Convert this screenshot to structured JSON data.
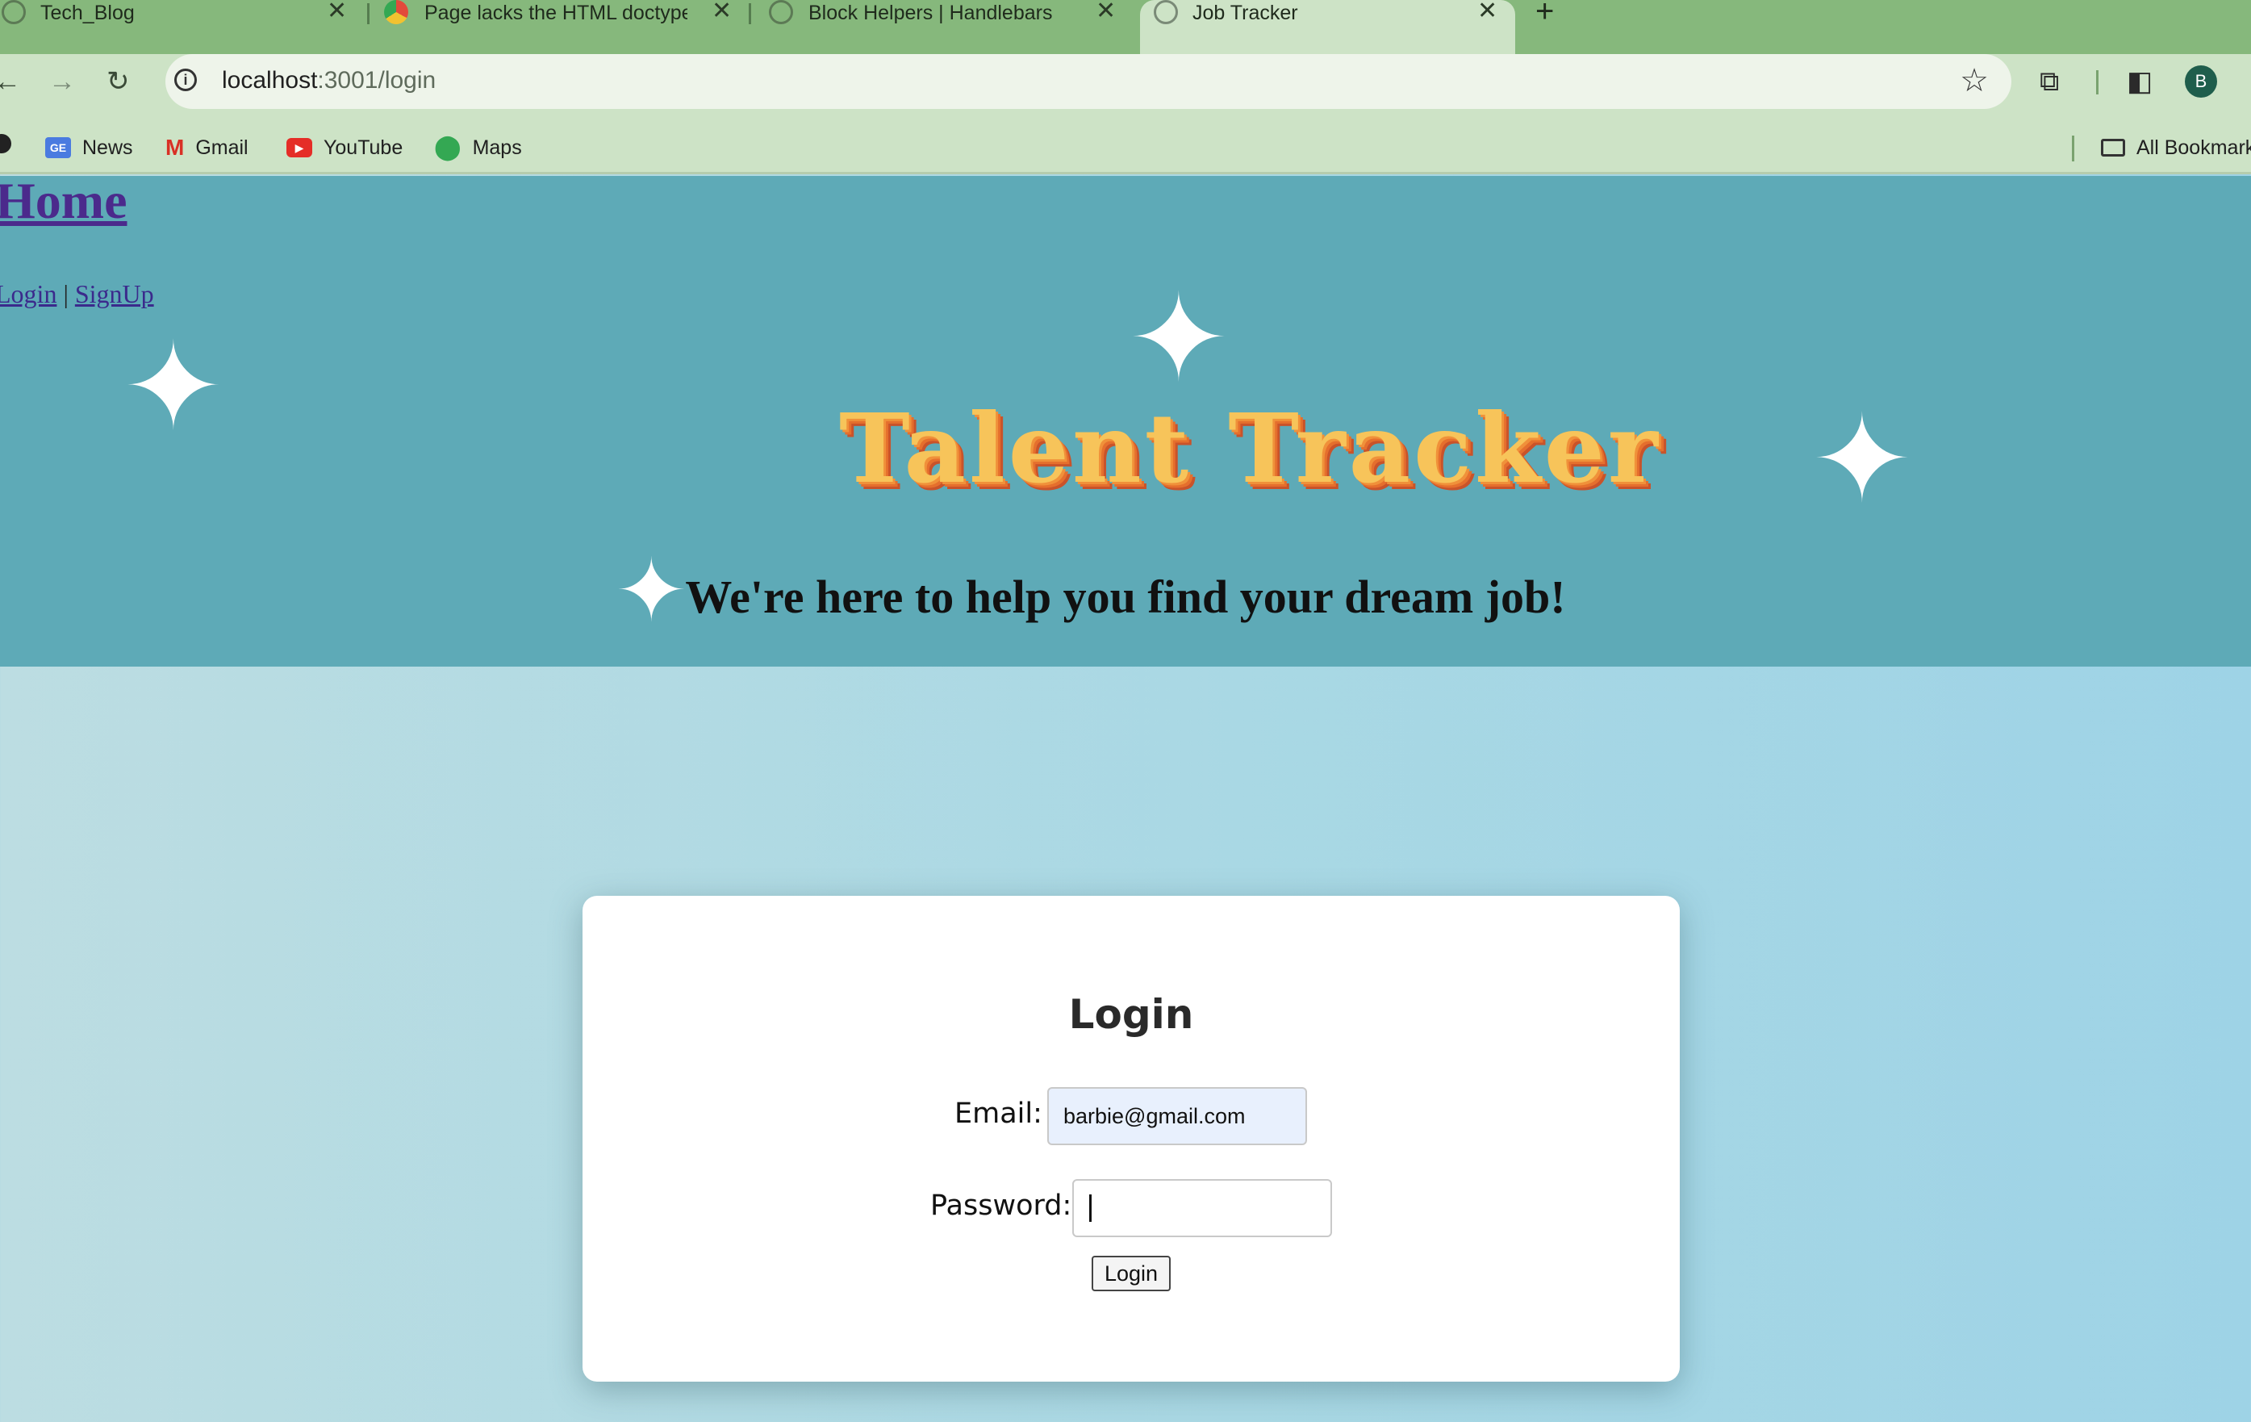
{
  "browser": {
    "tabs": [
      {
        "title": "Tech_Blog",
        "favicon": "globe-icon",
        "active": false
      },
      {
        "title": "Page lacks the HTML doctype",
        "favicon": "chrome-icon",
        "active": false
      },
      {
        "title": "Block Helpers | Handlebars",
        "favicon": "globe-icon",
        "active": false
      },
      {
        "title": "Job Tracker",
        "favicon": "globe-icon",
        "active": true
      }
    ],
    "close_glyph": "✕",
    "new_tab_glyph": "+",
    "url_host": "localhost",
    "url_path": ":3001/login",
    "profile_initial": "B",
    "bookmarks": [
      {
        "label": "News",
        "icon": "google-news-icon"
      },
      {
        "label": "Gmail",
        "icon": "gmail-icon"
      },
      {
        "label": "YouTube",
        "icon": "youtube-icon"
      },
      {
        "label": "Maps",
        "icon": "maps-icon"
      }
    ],
    "all_bookmarks": "All Bookmarks"
  },
  "page": {
    "home_link": "Home",
    "nav": {
      "login": "Login",
      "separator": "|",
      "signup": "SignUp"
    },
    "logo_text": "Talent Tracker",
    "tagline": "We're here to help you find your dream job!"
  },
  "login_form": {
    "title": "Login",
    "email_label": "Email:",
    "email_value": "barbie@gmail.com",
    "password_label": "Password:",
    "password_value": "",
    "submit_label": "Login"
  },
  "colors": {
    "tab_bar": "#86b87c",
    "toolbar": "#cde3c6",
    "header_band": "#5eaab7",
    "home_link": "#4b2a8c",
    "logo": "#f7c45a"
  }
}
